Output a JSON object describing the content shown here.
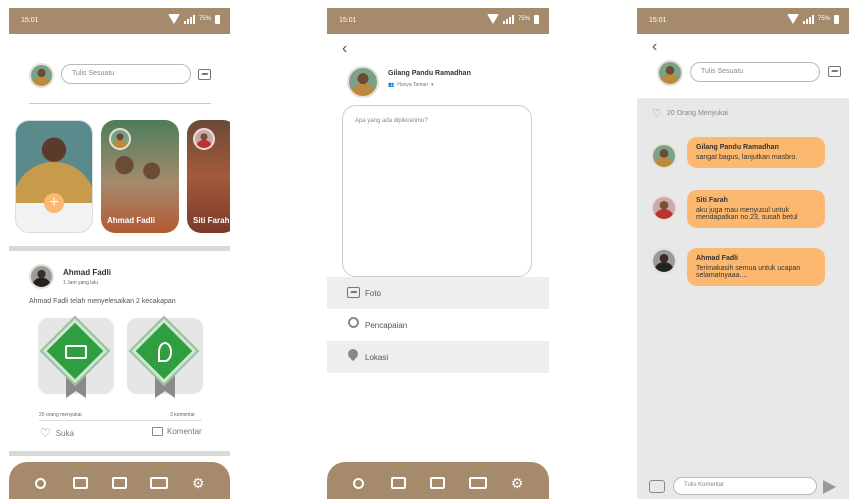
{
  "status": {
    "time": "15:01",
    "battery": "75%"
  },
  "colors": {
    "brand": "#a58a6c",
    "accent": "#fdb870",
    "badge_green": "#2e9e41"
  },
  "feed": {
    "compose_placeholder": "Tulis Sesuatu",
    "stories": [
      {
        "label": ""
      },
      {
        "label": "Ahmad Fadli"
      },
      {
        "label": "Siti Farah"
      }
    ],
    "post": {
      "author": "Ahmad Fadli",
      "time": "1 Jam yang lalu",
      "text": "Ahmad Fadli telah menyelesaikan 2 kecakapan",
      "likes": "20 orang menyukai",
      "comments": "3 komentar",
      "like_label": "Suka",
      "comment_label": "Komentar"
    }
  },
  "create_post": {
    "author": "Gilang Pandu Ramadhan",
    "audience": "Hanya Teman",
    "placeholder": "Apa yang ada dipikiranmu?",
    "options": [
      {
        "label": "Foto",
        "icon": "image-icon"
      },
      {
        "label": "Pencapaian",
        "icon": "medal-icon"
      },
      {
        "label": "Lokasi",
        "icon": "location-pin-icon"
      }
    ]
  },
  "comments": {
    "compose_placeholder": "Tulis Sesuatu",
    "likes_text": "20 Orang Menyukai",
    "items": [
      {
        "name": "Gilang Pandu Ramadhan",
        "text": "sangat bagus, lanjutkan masbro."
      },
      {
        "name": "Siti Farah",
        "text": "aku juga mau menyusul untuk mendapatkan no.23, susah betul"
      },
      {
        "name": "Ahmad Fadli",
        "text": "Terimakasih semua untuk ucapan selamatnyaaa...."
      }
    ],
    "comment_placeholder": "Tulis Komentar"
  },
  "nav_icons": [
    "medal-icon",
    "news-icon",
    "gallery-icon",
    "chat-icon",
    "settings-icon"
  ]
}
